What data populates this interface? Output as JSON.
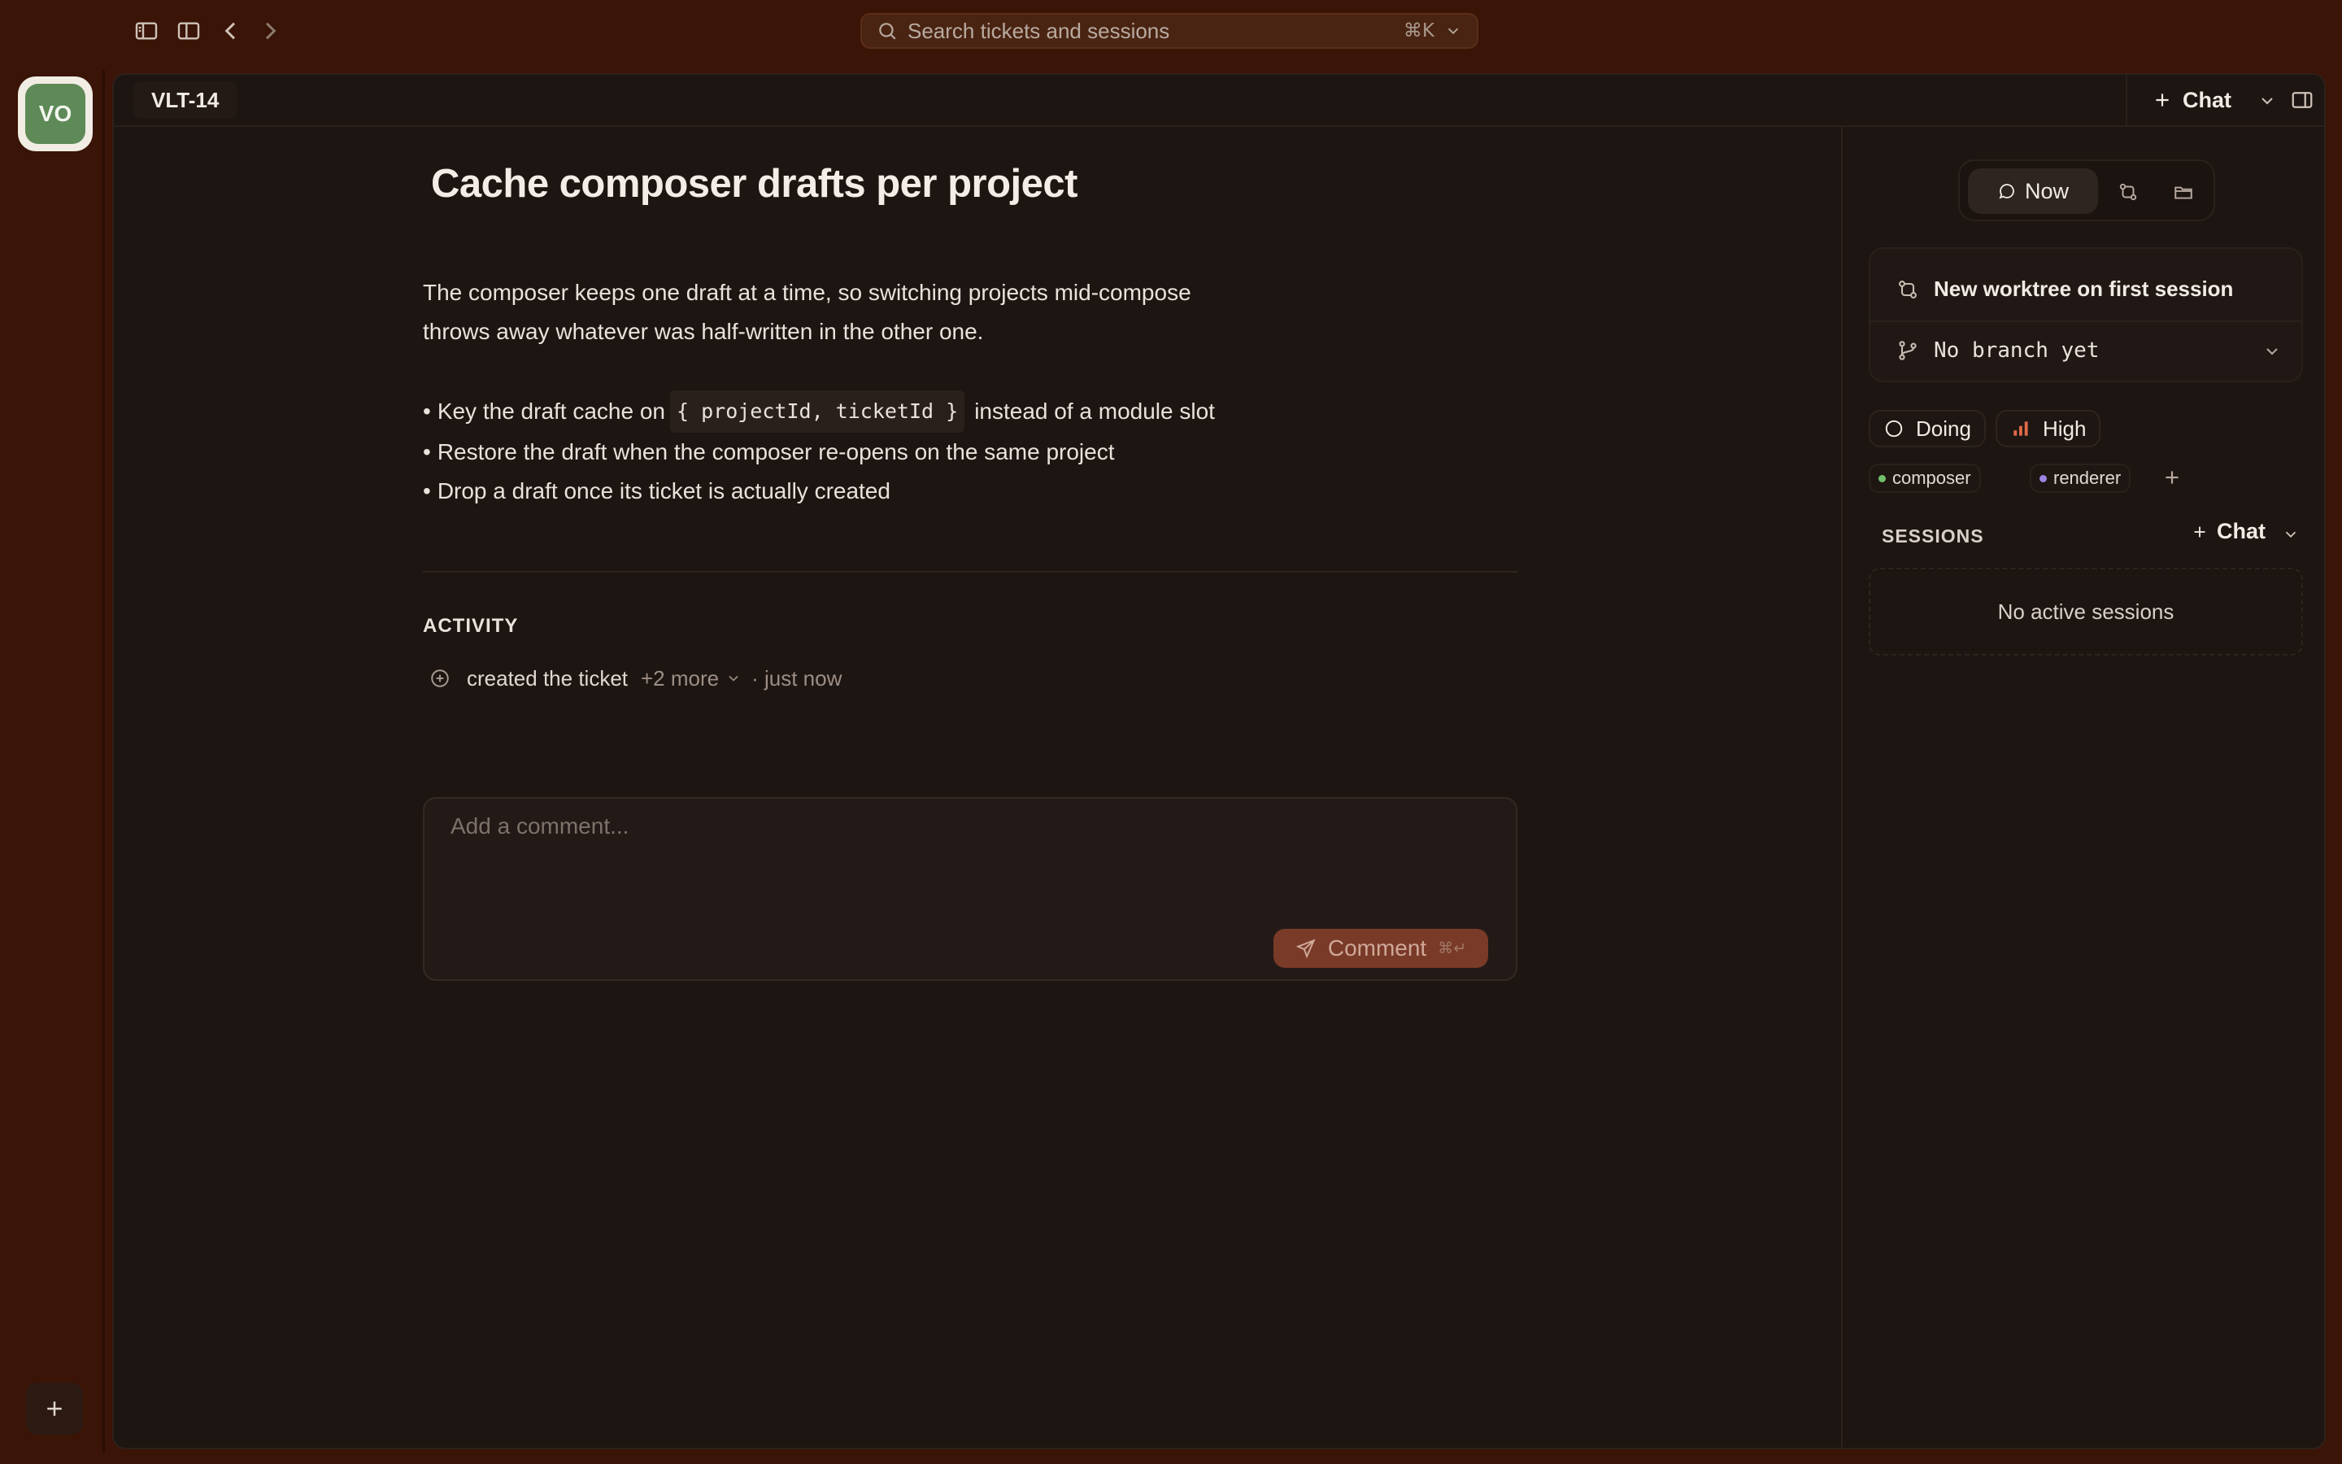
{
  "topbar": {
    "search_placeholder": "Search tickets and sessions",
    "search_shortcut": "⌘K"
  },
  "workspace": {
    "avatar_initials": "VO",
    "avatar_color": "#5e8a57"
  },
  "tab": {
    "label": "VLT-14",
    "chat_label": "Chat"
  },
  "ticket": {
    "title": "Cache composer drafts per project",
    "description_lines": [
      "The composer keeps one draft at a time, so switching projects mid-compose",
      "throws away whatever was half-written in the other one."
    ],
    "bullet1": {
      "prefix": "Key the draft cache on",
      "code": "{ projectId, ticketId }",
      "suffix": "instead of a module slot"
    },
    "bullet2": "Restore the draft when the composer re-opens on the same project",
    "bullet3": "Drop a draft once its ticket is actually created",
    "bullet_marker": "•"
  },
  "activity": {
    "heading": "ACTIVITY",
    "event_text": "created the ticket",
    "more_label": "+2 more",
    "time": "· just now"
  },
  "comment": {
    "placeholder": "Add a comment...",
    "button_label": "Comment",
    "button_shortcut": "⌘↵"
  },
  "side": {
    "segment_now": "Now",
    "worktree_label": "New worktree on first session",
    "branch_label": "No branch yet",
    "status": "Doing",
    "priority": "High",
    "priority_color": "#e06a4a",
    "tags": [
      {
        "label": "composer",
        "color": "#6fbf6a"
      },
      {
        "label": "renderer",
        "color": "#9a84e0"
      }
    ],
    "sessions_heading": "SESSIONS",
    "sessions_chat_label": "Chat",
    "sessions_empty": "No active sessions"
  }
}
